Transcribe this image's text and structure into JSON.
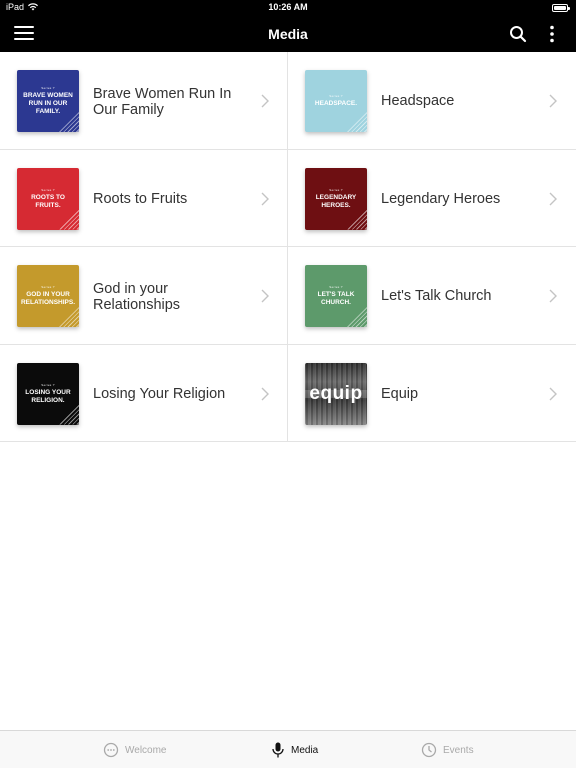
{
  "status_bar": {
    "device": "iPad",
    "time": "10:26 AM"
  },
  "nav": {
    "title": "Media"
  },
  "series": [
    {
      "title": "Brave Women Run In Our Family",
      "thumb_title": "BRAVE WOMEN RUN IN OUR FAMILY.",
      "thumb_series": "Series ?",
      "color": "#2c3891"
    },
    {
      "title": "Headspace",
      "thumb_title": "HEADSPACE.",
      "thumb_series": "Series ?",
      "color": "#9fd3df"
    },
    {
      "title": "Roots to Fruits",
      "thumb_title": "ROOTS TO FRUITS.",
      "thumb_series": "Series ?",
      "color": "#d62a33"
    },
    {
      "title": "Legendary Heroes",
      "thumb_title": "LEGENDARY HEROES.",
      "thumb_series": "Series ?",
      "color": "#6e0f12"
    },
    {
      "title": "God in your Relationships",
      "thumb_title": "GOD IN YOUR RELATIONSHIPS.",
      "thumb_series": "Series ?",
      "color": "#c49a2c"
    },
    {
      "title": "Let's Talk Church",
      "thumb_title": "LET'S TALK CHURCH.",
      "thumb_series": "Series ?",
      "color": "#5d9a6b"
    },
    {
      "title": "Losing Your Religion",
      "thumb_title": "LOSING YOUR RELIGION.",
      "thumb_series": "Series ?",
      "color": "#0b0b0b"
    },
    {
      "title": "Equip",
      "thumb_title": "equip",
      "thumb_series": "",
      "color": "#555555"
    }
  ],
  "tabs": [
    {
      "label": "Welcome",
      "icon": "chat-bubble-icon",
      "active": false
    },
    {
      "label": "Media",
      "icon": "microphone-icon",
      "active": true
    },
    {
      "label": "Events",
      "icon": "clock-icon",
      "active": false
    }
  ]
}
